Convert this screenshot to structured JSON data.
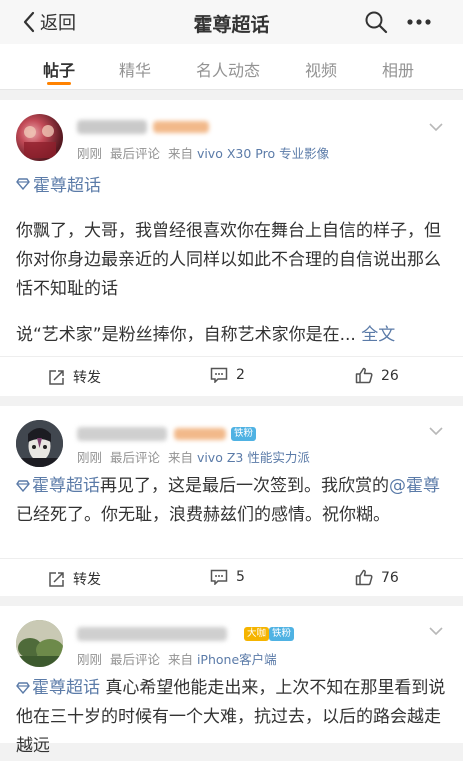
{
  "nav": {
    "back_label": "返回",
    "title": "霍尊超话"
  },
  "tabs": [
    "帖子",
    "精华",
    "名人动态",
    "视频",
    "相册"
  ],
  "posts": [
    {
      "meta_time": "刚刚",
      "meta_comment": "最后评论",
      "meta_source_prefix": "来自",
      "meta_source": "vivo X30 Pro 专业影像",
      "topic": "霍尊超话",
      "text1": "你飘了，大哥，我曾经很喜欢你在舞台上自信的样子，但你对你身边最亲近的人同样以如此不合理的自信说出那么恬不知耻的话",
      "text2": "说“艺术家”是粉丝捧你，自称艺术家你是在...",
      "more": "全文",
      "repost": "转发",
      "comments": "2",
      "likes": "26"
    },
    {
      "badge": "铁粉",
      "meta_time": "刚刚",
      "meta_comment": "最后评论",
      "meta_source_prefix": "来自",
      "meta_source": "vivo Z3 性能实力派",
      "topic": "霍尊超话",
      "text_a": "再见了，这是最后一次签到。我欣赏的",
      "mention": "@霍尊",
      "text_b": " 已经死了。你无耻，浪费赫兹们的感情。祝你糊。",
      "repost": "转发",
      "comments": "5",
      "likes": "76"
    },
    {
      "badge_a": "大咖",
      "badge_b": "铁粉",
      "meta_time": "刚刚",
      "meta_comment": "最后评论",
      "meta_source_prefix": "来自",
      "meta_source": "iPhone客户端",
      "topic": "霍尊超话",
      "text": " 真心希望他能走出来，上次不知在那里看到说他在三十岁的时候有一个大难，抗过去，以后的路会越走越远"
    }
  ],
  "colors": {
    "accent": "#ff8200",
    "link": "#5b7ba8",
    "badge_fan": "#4fb2e3",
    "badge_vip": "#f5b400"
  }
}
